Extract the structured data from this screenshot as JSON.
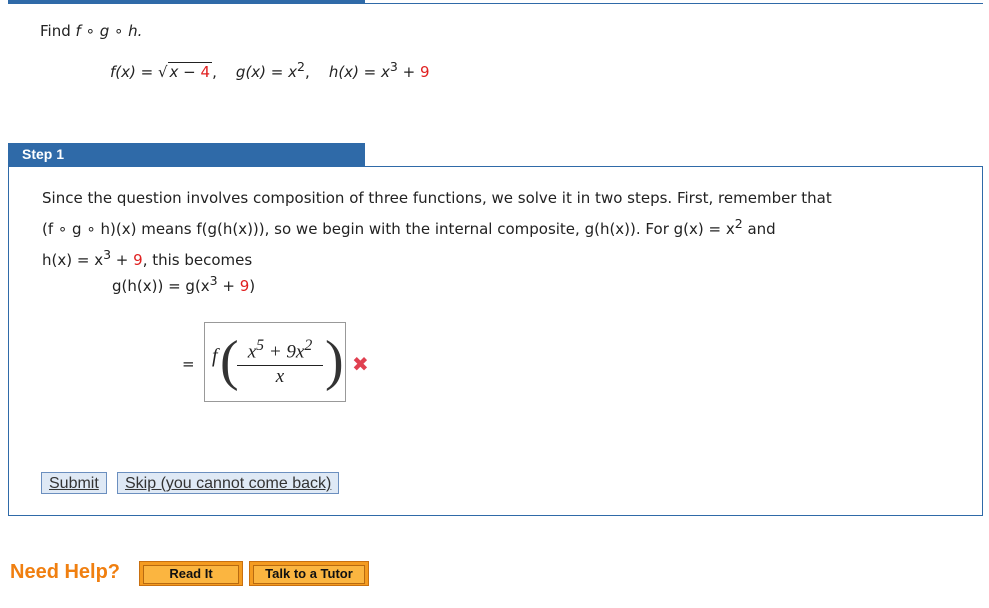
{
  "question": {
    "prompt": "Find",
    "composition": "f ∘ g ∘ h.",
    "f": {
      "lhs": "f(x) = ",
      "radicand": "x − ",
      "red": "4",
      "tail": ","
    },
    "g": {
      "lhs": "g(x) = x",
      "exp": "2",
      "tail": ","
    },
    "h": {
      "lhs": "h(x) = x",
      "exp": "3",
      "mid": " + ",
      "red": "9"
    }
  },
  "step": {
    "title": "Step 1",
    "line1": "Since the question involves composition of three functions, we solve it in two steps. First, remember that",
    "line2": "(f ∘ g ∘ h)(x)  means  f(g(h(x))),  so we begin with the internal composite,  g(h(x)).  For  g(x) = x",
    "line2_exp": "2",
    "line2_tail": "  and",
    "line3_a": "h(x) = x",
    "line3_exp": "3",
    "line3_mid": " + ",
    "line3_red": "9",
    "line3_tail": ",  this becomes",
    "eq_lhs": "g(h(x))  =  g(x",
    "eq_exp": "3",
    "eq_mid": " + ",
    "eq_red": "9",
    "eq_close": ")",
    "eq2_sign": "=",
    "answer": {
      "f": "f",
      "num_a": "x",
      "num_a_exp": "5",
      "num_mid": " + 9x",
      "num_b_exp": "2",
      "den": "x"
    },
    "status_icon": "x-mark-icon",
    "status": "incorrect"
  },
  "buttons": {
    "submit": "Submit",
    "skip": "Skip (you cannot come back)"
  },
  "help": {
    "label": "Need Help?",
    "read": "Read It",
    "tutor": "Talk to a Tutor"
  },
  "colors": {
    "accent": "#2f6aa8",
    "error": "#e04050",
    "help": "#f07f10",
    "highlight": "#e02020"
  }
}
